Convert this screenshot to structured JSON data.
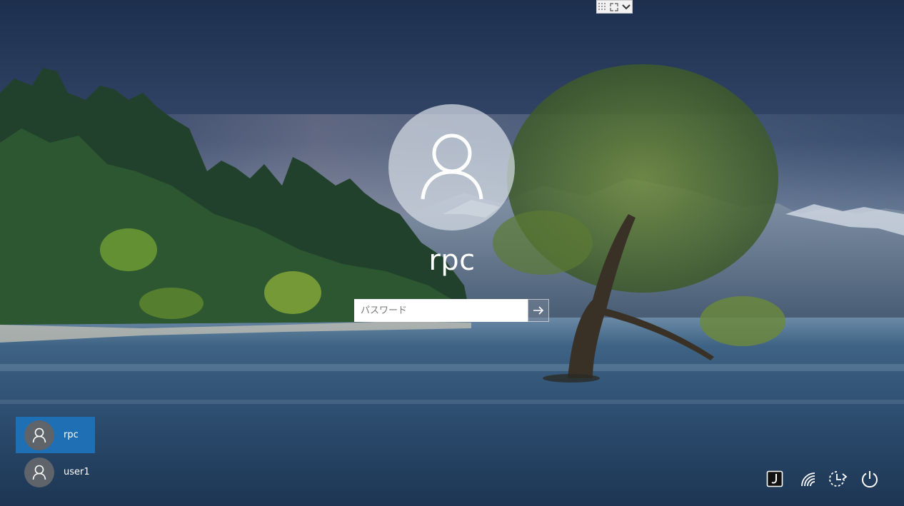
{
  "remote_bar": {
    "icons": [
      "pin-grid-icon",
      "restore-icon",
      "chevron-down-icon"
    ]
  },
  "login": {
    "username": "rpc",
    "password_placeholder": "パスワード",
    "submit_icon": "arrow-right-icon"
  },
  "user_list": [
    {
      "name": "rpc",
      "selected": true
    },
    {
      "name": "user1",
      "selected": false
    }
  ],
  "system_icons": [
    "ease-of-access-icon",
    "wifi-icon",
    "accessibility-icon",
    "power-icon"
  ],
  "colors": {
    "selected_user_bg": "#1f6fb5",
    "accent": "#1f6fb5"
  }
}
